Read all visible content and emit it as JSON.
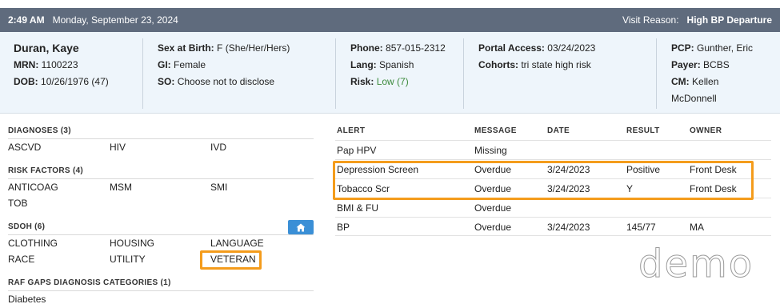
{
  "header": {
    "time": "2:49 AM",
    "date": "Monday, September 23, 2024",
    "visit_reason_label": "Visit Reason:",
    "visit_reason_value": "High BP Departure"
  },
  "patient": {
    "name": "Duran, Kaye",
    "mrn_label": "MRN:",
    "mrn": "1100223",
    "dob_label": "DOB:",
    "dob": "10/26/1976 (47)",
    "sex_label": "Sex at Birth:",
    "sex": "F (She/Her/Hers)",
    "gi_label": "GI:",
    "gi": "Female",
    "so_label": "SO:",
    "so": "Choose not to disclose",
    "phone_label": "Phone:",
    "phone": "857-015-2312",
    "lang_label": "Lang:",
    "lang": "Spanish",
    "risk_label": "Risk:",
    "risk": "Low (7)",
    "portal_label": "Portal Access:",
    "portal": "03/24/2023",
    "cohorts_label": "Cohorts:",
    "cohorts": "tri state high risk",
    "pcp_label": "PCP:",
    "pcp": "Gunther, Eric",
    "payer_label": "Payer:",
    "payer": "BCBS",
    "cm_label": "CM:",
    "cm_line1": "Kellen",
    "cm_line2": "McDonnell"
  },
  "diagnoses": {
    "title": "DIAGNOSES (3)",
    "items": [
      "ASCVD",
      "HIV",
      "IVD"
    ]
  },
  "risk_factors": {
    "title": "RISK FACTORS (4)",
    "items": [
      "ANTICOAG",
      "MSM",
      "SMI",
      "TOB"
    ]
  },
  "sdoh": {
    "title": "SDOH (6)",
    "items": [
      "CLOTHING",
      "HOUSING",
      "LANGUAGE",
      "RACE",
      "UTILITY",
      "VETERAN"
    ]
  },
  "raf": {
    "title": "RAF GAPS DIAGNOSIS CATEGORIES (1)",
    "items": [
      "Diabetes"
    ]
  },
  "alerts": {
    "headers": [
      "ALERT",
      "MESSAGE",
      "DATE",
      "RESULT",
      "OWNER"
    ],
    "rows": [
      [
        "Pap HPV",
        "Missing",
        "",
        "",
        ""
      ],
      [
        "Depression Screen",
        "Overdue",
        "3/24/2023",
        "Positive",
        "Front Desk"
      ],
      [
        "Tobacco Scr",
        "Overdue",
        "3/24/2023",
        "Y",
        "Front Desk"
      ],
      [
        "BMI & FU",
        "Overdue",
        "",
        "",
        ""
      ],
      [
        "BP",
        "Overdue",
        "3/24/2023",
        "145/77",
        "MA"
      ]
    ]
  },
  "watermark": "demo",
  "colors": {
    "topbar": "#5f6b7d",
    "patient_bg": "#eef5fb",
    "highlight": "#f49c1c",
    "home_button": "#3a8fd6",
    "risk_low": "#3c8a3c"
  },
  "icons": {
    "home_button": "home-icon"
  }
}
